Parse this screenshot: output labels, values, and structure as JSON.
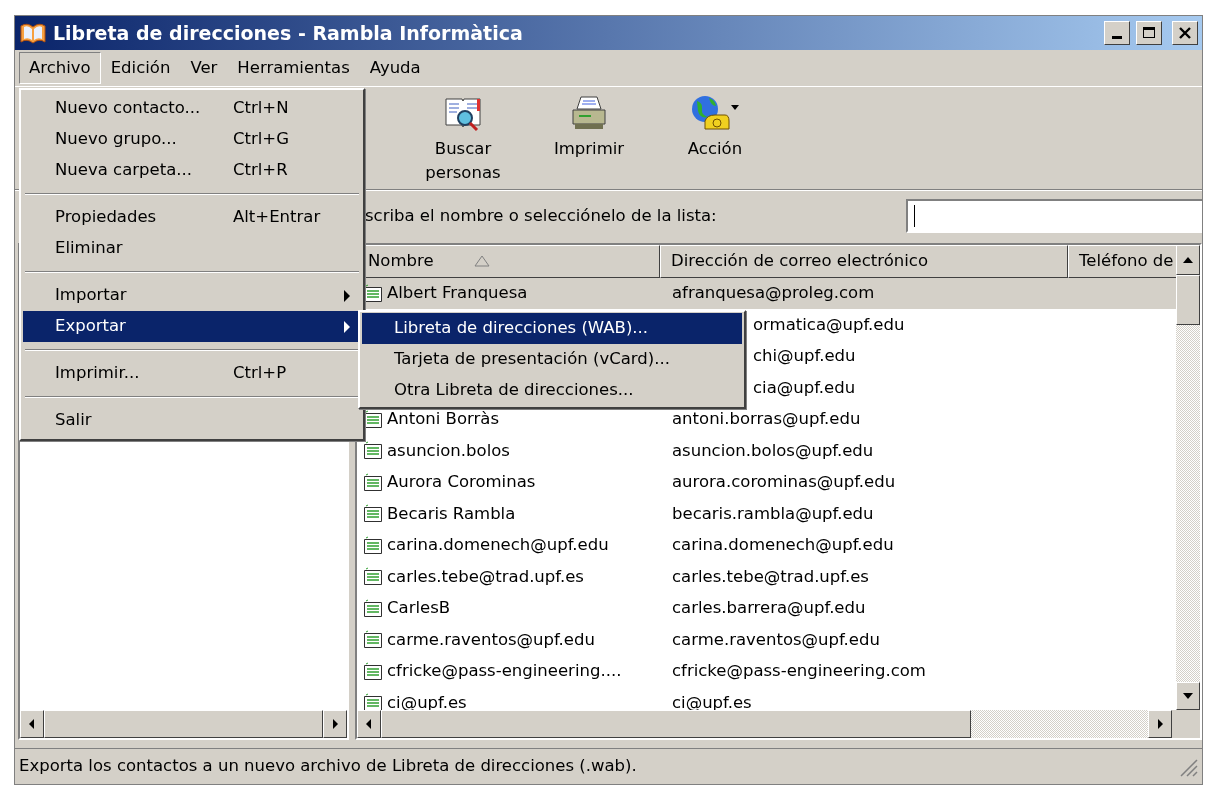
{
  "window": {
    "title": "Libreta de direcciones - Rambla Informàtica"
  },
  "menu_bar": [
    {
      "label": "Archivo",
      "selected": true
    },
    {
      "label": "Edición",
      "selected": false
    },
    {
      "label": "Ver",
      "selected": false
    },
    {
      "label": "Herramientas",
      "selected": false
    },
    {
      "label": "Ayuda",
      "selected": false
    }
  ],
  "file_menu": [
    {
      "kind": "item",
      "label": "Nuevo contacto...",
      "shortcut": "Ctrl+N",
      "selected": false
    },
    {
      "kind": "item",
      "label": "Nuevo grupo...",
      "shortcut": "Ctrl+G",
      "selected": false
    },
    {
      "kind": "item",
      "label": "Nueva carpeta...",
      "shortcut": "Ctrl+R",
      "selected": false
    },
    {
      "kind": "separator"
    },
    {
      "kind": "item",
      "label": "Propiedades",
      "shortcut": "Alt+Entrar",
      "selected": false
    },
    {
      "kind": "item",
      "label": "Eliminar",
      "selected": false
    },
    {
      "kind": "separator"
    },
    {
      "kind": "submenu",
      "label": "Importar",
      "selected": false
    },
    {
      "kind": "submenu",
      "label": "Exportar",
      "selected": true
    },
    {
      "kind": "separator"
    },
    {
      "kind": "item",
      "label": "Imprimir...",
      "shortcut": "Ctrl+P",
      "selected": false
    },
    {
      "kind": "separator"
    },
    {
      "kind": "item",
      "label": "Salir",
      "selected": false
    }
  ],
  "export_submenu": [
    {
      "label": "Libreta de direcciones (WAB)...",
      "selected": true
    },
    {
      "label": "Tarjeta de presentación (vCard)...",
      "selected": false
    },
    {
      "label": "Otra Libreta de direcciones...",
      "selected": false
    }
  ],
  "toolbar": [
    {
      "kind": "find",
      "label": "Buscar personas"
    },
    {
      "kind": "print",
      "label": "Imprimir"
    },
    {
      "kind": "action",
      "label": "Acción"
    }
  ],
  "search": {
    "label": "scriba el nombre o selecciónelo de la lista:"
  },
  "contacts": {
    "columns": [
      {
        "label": "Nombre",
        "sorted": true
      },
      {
        "label": "Dirección de correo electrónico"
      },
      {
        "label": "Teléfono de"
      }
    ],
    "rows": [
      {
        "kind": "contact",
        "name": "Albert Franquesa",
        "email": "afranquesa@proleg.com",
        "selected": true
      },
      {
        "kind": "covered",
        "email": "ormatica@upf.edu",
        "selected": false
      },
      {
        "kind": "covered",
        "email": "chi@upf.edu",
        "selected": false
      },
      {
        "kind": "covered",
        "email": "cia@upf.edu",
        "selected": false
      },
      {
        "kind": "contact",
        "name": "Antoni Borràs",
        "email": "antoni.borras@upf.edu",
        "selected": false
      },
      {
        "kind": "contact",
        "name": "asuncion.bolos",
        "email": "asuncion.bolos@upf.edu",
        "selected": false
      },
      {
        "kind": "contact",
        "name": "Aurora Corominas",
        "email": "aurora.corominas@upf.edu",
        "selected": false
      },
      {
        "kind": "contact",
        "name": "Becaris Rambla",
        "email": "becaris.rambla@upf.edu",
        "selected": false
      },
      {
        "kind": "contact",
        "name": "carina.domenech@upf.edu",
        "email": "carina.domenech@upf.edu",
        "selected": false
      },
      {
        "kind": "contact",
        "name": "carles.tebe@trad.upf.es",
        "email": "carles.tebe@trad.upf.es",
        "selected": false
      },
      {
        "kind": "contact",
        "name": "CarlesB",
        "email": "carles.barrera@upf.edu",
        "selected": false
      },
      {
        "kind": "contact",
        "name": "carme.raventos@upf.edu",
        "email": "carme.raventos@upf.edu",
        "selected": false
      },
      {
        "kind": "contact",
        "name": "cfricke@pass-engineering....",
        "email": "cfricke@pass-engineering.com",
        "selected": false
      },
      {
        "kind": "contact",
        "name": "ci@upf.es",
        "email": "ci@upf.es",
        "selected": false
      }
    ]
  },
  "status_bar": {
    "text": "Exporta los contactos a un nuevo archivo de Libreta de direcciones (.wab)."
  }
}
